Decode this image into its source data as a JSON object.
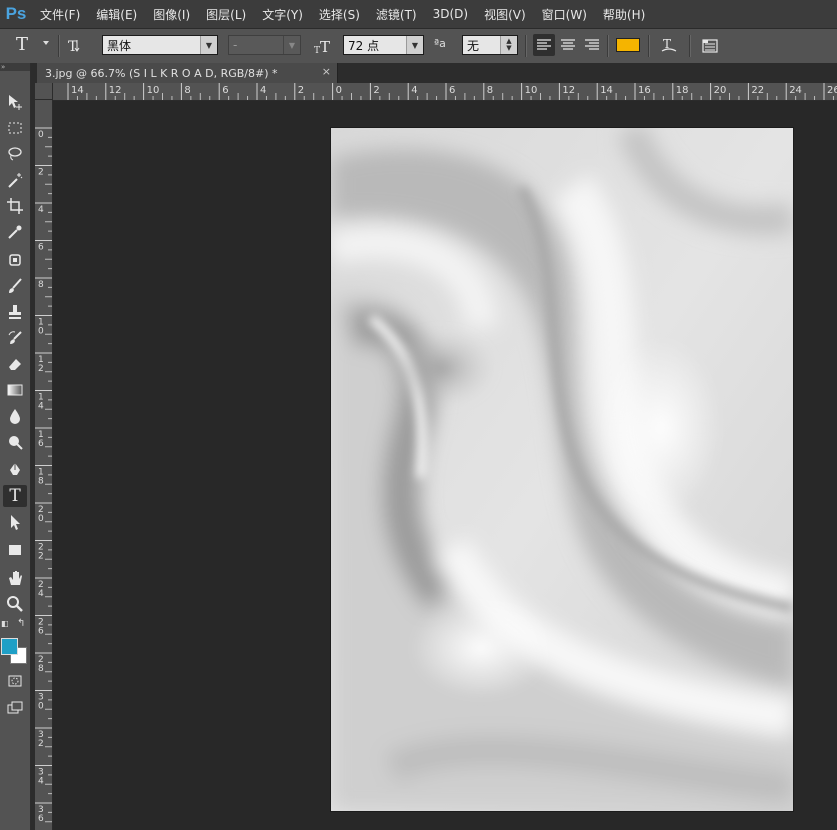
{
  "app": {
    "logo": "Ps"
  },
  "menu": [
    "文件(F)",
    "编辑(E)",
    "图像(I)",
    "图层(L)",
    "文字(Y)",
    "选择(S)",
    "滤镜(T)",
    "3D(D)",
    "视图(V)",
    "窗口(W)",
    "帮助(H)"
  ],
  "options": {
    "tool_icon": "T",
    "font_family": "黑体",
    "font_style": "-",
    "font_size": "72 点",
    "antialias_icon_text": "ªa",
    "antialias": "无",
    "text_color": "#f5b400"
  },
  "document": {
    "tab_title": "3.jpg @ 66.7% (S  I  L  K  R  O  A  D, RGB/8#) *",
    "close_label": "×"
  },
  "rulers": {
    "top": [
      "14",
      "12",
      "10",
      "8",
      "6",
      "4",
      "2",
      "0",
      "2",
      "4",
      "6",
      "8",
      "10",
      "12",
      "14",
      "16",
      "18",
      "20",
      "22",
      "24",
      "26"
    ],
    "left": [
      "0",
      "2",
      "4",
      "6",
      "8",
      "10",
      "12",
      "14",
      "16",
      "18",
      "20",
      "22",
      "24",
      "26",
      "28",
      "30",
      "32",
      "34",
      "36"
    ]
  },
  "colors": {
    "foreground": "#1f9fc6",
    "background": "#ffffff",
    "canvas_bg": "#282828",
    "panel": "#535353"
  },
  "tools": [
    "move-tool",
    "marquee-tool",
    "lasso-tool",
    "magic-wand-tool",
    "crop-tool",
    "eyedropper-tool",
    "spot-healing-tool",
    "brush-tool",
    "clone-stamp-tool",
    "history-brush-tool",
    "eraser-tool",
    "gradient-tool",
    "blur-tool",
    "dodge-tool",
    "pen-tool",
    "type-tool",
    "path-selection-tool",
    "rectangle-tool",
    "hand-tool",
    "zoom-tool"
  ]
}
